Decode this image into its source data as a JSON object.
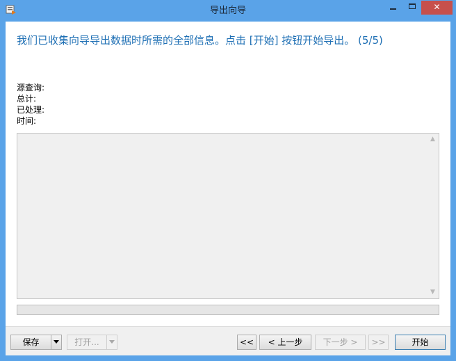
{
  "window": {
    "title": "导出向导",
    "app_icon": "export-wizard-icon",
    "controls": {
      "minimize": "minimize-icon",
      "maximize": "maximize-icon",
      "close": "✕"
    }
  },
  "heading": "我们已收集向导导出数据时所需的全部信息。点击 [开始] 按钮开始导出。 (5/5)",
  "info": {
    "source_query_label": "源查询:",
    "total_label": "总计:",
    "processed_label": "已处理:",
    "time_label": "时间:"
  },
  "log": {
    "text": "",
    "scroll_up": "▲",
    "scroll_down": "▼"
  },
  "progress": {
    "value": 0
  },
  "buttons": {
    "save": "保存",
    "open": "打开...",
    "first": "<<",
    "prev": "< 上一步",
    "next": "下一步 >",
    "last": ">>",
    "start": "开始"
  }
}
